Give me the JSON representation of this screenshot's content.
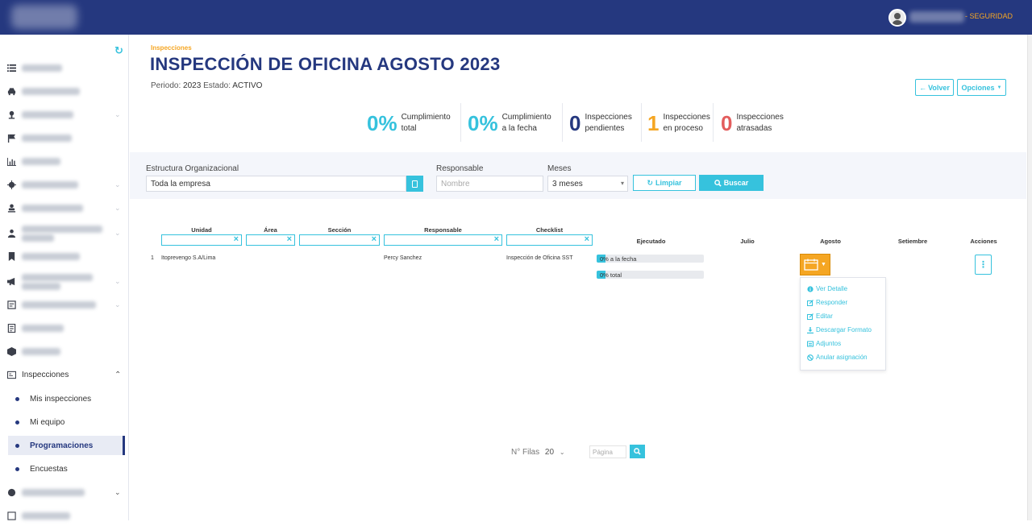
{
  "header": {
    "user_role": "- SEGURIDAD"
  },
  "sidebar": {
    "section_label": "Inspecciones",
    "sub_items": [
      {
        "label": "Mis inspecciones"
      },
      {
        "label": "Mi equipo"
      },
      {
        "label": "Programaciones"
      },
      {
        "label": "Encuestas"
      }
    ]
  },
  "page": {
    "breadcrumb": "Inspecciones",
    "title": "INSPECCIÓN DE OFICINA AGOSTO 2023",
    "period_label": "Periodo:",
    "period_value": "2023",
    "state_label": "Estado:",
    "state_value": "ACTIVO",
    "back_label": "Volver",
    "options_label": "Opciones"
  },
  "kpis": [
    {
      "value": "0%",
      "label1": "Cumplimiento",
      "label2": "total",
      "color": "#36c2dd"
    },
    {
      "value": "0%",
      "label1": "Cumplimiento",
      "label2": "a la fecha",
      "color": "#36c2dd"
    },
    {
      "value": "0",
      "label1": "Inspecciones",
      "label2": "pendientes",
      "color": "#25387f"
    },
    {
      "value": "1",
      "label1": "Inspecciones",
      "label2": "en proceso",
      "color": "#f5a623"
    },
    {
      "value": "0",
      "label1": "Inspecciones",
      "label2": "atrasadas",
      "color": "#e35d5d"
    }
  ],
  "filters": {
    "org_label": "Estructura Organizacional",
    "org_value": "Toda la empresa",
    "resp_label": "Responsable",
    "resp_placeholder": "Nombre",
    "months_label": "Meses",
    "months_value": "3 meses",
    "clear_label": "Limpiar",
    "search_label": "Buscar"
  },
  "table": {
    "headers": {
      "unidad": "Unidad",
      "area": "Área",
      "seccion": "Sección",
      "responsable": "Responsable",
      "checklist": "Checklist",
      "ejecutado": "Ejecutado",
      "julio": "Julio",
      "agosto": "Agosto",
      "setiembre": "Setiembre",
      "acciones": "Acciones"
    },
    "rows": [
      {
        "index": "1",
        "unidad": "Itoprevengo S.A/Lima",
        "responsable": "Percy Sanchez",
        "checklist": "Inspección de Oficina SST",
        "progress_fecha_label": "0% a la fecha",
        "progress_fecha": 0,
        "progress_total_label": "0% total",
        "progress_total": 0
      }
    ]
  },
  "dropdown": {
    "items": [
      {
        "label": "Ver Detalle"
      },
      {
        "label": "Responder"
      },
      {
        "label": "Editar"
      },
      {
        "label": "Descargar Formato"
      },
      {
        "label": "Adjuntos"
      },
      {
        "label": "Anular asignación"
      }
    ]
  },
  "pagination": {
    "rows_label": "N° Filas",
    "rows_value": "20",
    "page_placeholder": "Página"
  },
  "colors": {
    "primary": "#25387f",
    "accent": "#36c2dd",
    "warning": "#f5a623"
  }
}
